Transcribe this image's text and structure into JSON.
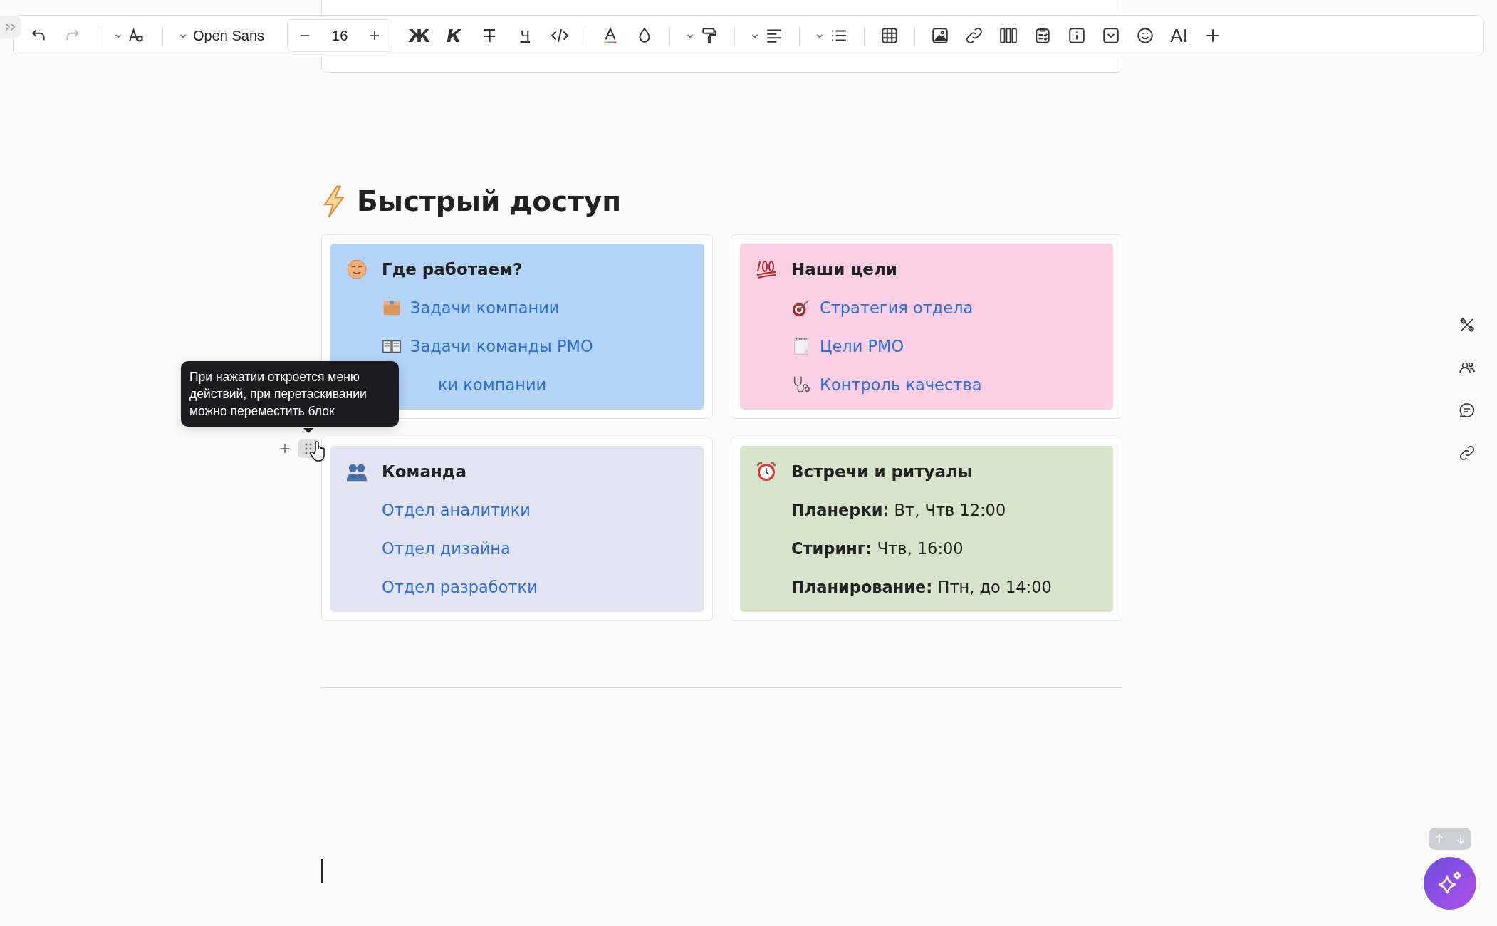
{
  "toolbar": {
    "font": "Open Sans",
    "font_size": "16",
    "format_buttons": [
      {
        "kind": "bold",
        "label": "Ж"
      },
      {
        "kind": "italic",
        "label": "К"
      },
      {
        "kind": "strike",
        "label": "Т"
      },
      {
        "kind": "underline",
        "label": "Ч"
      }
    ],
    "ai_label": "AI"
  },
  "section": {
    "title": "Быстрый доступ",
    "cards": [
      {
        "title": "Где работаем?",
        "color": "#b3d4f7",
        "items": [
          {
            "kind": "link",
            "text": "Задачи компании"
          },
          {
            "kind": "link",
            "text": "Задачи команды РМО"
          },
          {
            "kind": "covered",
            "text": "ки компании"
          }
        ]
      },
      {
        "title": "Наши цели",
        "color": "#fbcfe3",
        "items": [
          {
            "kind": "link",
            "text": "Стратегия отдела"
          },
          {
            "kind": "link",
            "text": "Цели РМО"
          },
          {
            "kind": "link",
            "text": "Контроль качества"
          }
        ]
      },
      {
        "title": "Команда",
        "color": "#e3e4f3",
        "items": [
          {
            "kind": "link",
            "text": "Отдел аналитики"
          },
          {
            "kind": "link",
            "text": "Отдел дизайна"
          },
          {
            "kind": "link",
            "text": "Отдел разработки"
          }
        ]
      },
      {
        "title": "Встречи и ритуалы",
        "color": "#d6e4c9",
        "items": [
          {
            "kind": "schedule",
            "text": "**Планерки:** Вт, Чтв 12:00"
          },
          {
            "kind": "schedule",
            "text": "**Стиринг:** Чтв, 16:00"
          },
          {
            "kind": "schedule",
            "text": "**Планирование:** Птн, до 14:00"
          }
        ]
      }
    ]
  },
  "tooltip": {
    "text": "При нажатии откроется меню действий, при перетаскивании можно переместить блок"
  }
}
